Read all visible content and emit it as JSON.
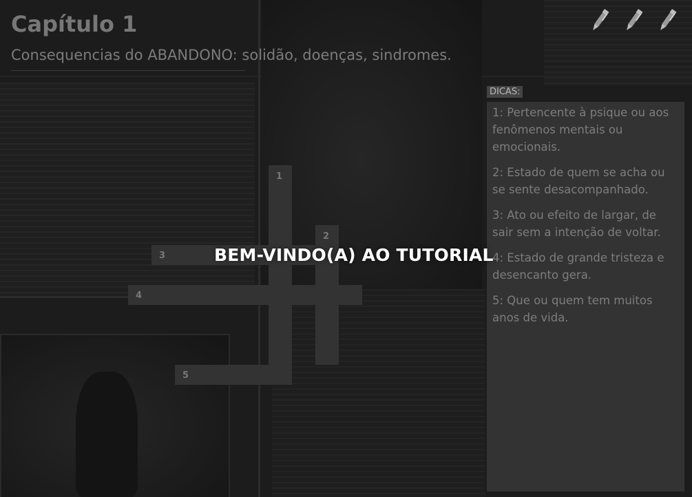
{
  "header": {
    "title": "Capítulo 1",
    "subtitle": "Consequencias do ABANDONO: solidão, doenças, sindromes."
  },
  "toolbar": {
    "pens": [
      {
        "icon": "pen-icon"
      },
      {
        "icon": "pen-icon"
      },
      {
        "icon": "pen-icon"
      }
    ]
  },
  "crossword": {
    "numbers": [
      "1",
      "2",
      "3",
      "4",
      "5"
    ]
  },
  "overlay": {
    "message": "BEM-VINDO(A) AO TUTORIAL"
  },
  "hints": {
    "tag": "DICAS:",
    "items": [
      "1: Pertencente à psique ou aos fenômenos mentais ou emocionais.",
      "2: Estado de quem se acha ou se sente desacompanhado.",
      "3: Ato ou efeito de largar, de sair sem a intenção de voltar.",
      "4: Estado de grande tristeza e desencanto gera.",
      "5: Que ou quem tem muitos anos de vida."
    ]
  },
  "colors": {
    "background": "#1c1c1c",
    "cell": "#333333",
    "panel": "#333333",
    "text_dim": "#7d7d7d",
    "overlay_text": "#ffffff"
  }
}
